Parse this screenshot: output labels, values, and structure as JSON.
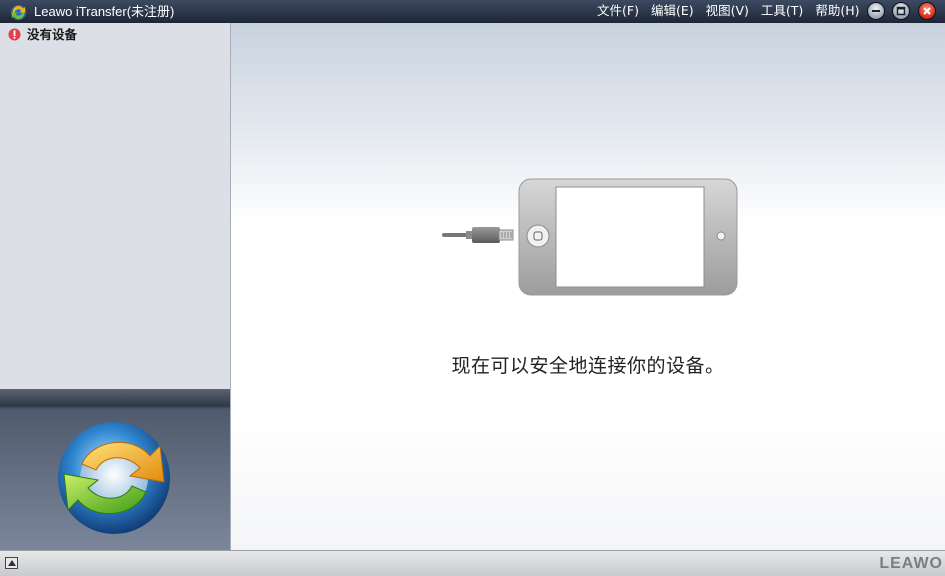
{
  "window": {
    "title": "Leawo iTransfer(未注册)",
    "menu": [
      "文件(F)",
      "编辑(E)",
      "视图(V)",
      "工具(T)",
      "帮助(H)"
    ]
  },
  "sidebar": {
    "status_icon": "warning-icon",
    "status_text": "没有设备"
  },
  "main": {
    "illustration": "phone-cable-icon",
    "message": "现在可以安全地连接你的设备。"
  },
  "statusbar": {
    "brand": "LEAWO"
  },
  "colors": {
    "titlebar": "#1d2637",
    "sidebar_bg": "#dcdfe5",
    "warning": "#e0414a",
    "close_button": "#d42a16"
  }
}
